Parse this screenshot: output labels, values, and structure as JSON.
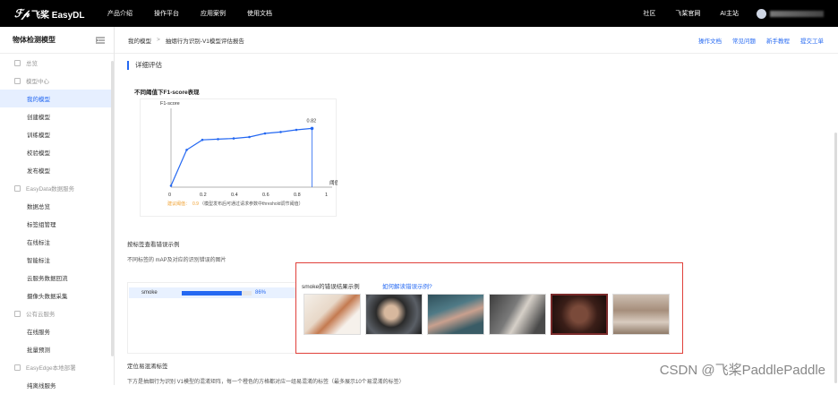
{
  "topbar": {
    "logo_mark": "飞桨",
    "logo_text": "飞桨 EasyDL",
    "nav": [
      "产品介绍",
      "操作平台",
      "应用案例",
      "使用文档"
    ],
    "right_links": [
      "社区",
      "飞桨官网",
      "AI主站"
    ]
  },
  "sidebar": {
    "title": "物体检测模型",
    "items": [
      {
        "label": "总览",
        "type": "group"
      },
      {
        "label": "模型中心",
        "type": "group"
      },
      {
        "label": "我的模型",
        "type": "item",
        "active": true
      },
      {
        "label": "创建模型",
        "type": "item"
      },
      {
        "label": "训练模型",
        "type": "item"
      },
      {
        "label": "校验模型",
        "type": "item"
      },
      {
        "label": "发布模型",
        "type": "item"
      },
      {
        "label": "EasyData数据服务",
        "type": "group"
      },
      {
        "label": "数据总览",
        "type": "item"
      },
      {
        "label": "标签组管理",
        "type": "item"
      },
      {
        "label": "在线标注",
        "type": "item"
      },
      {
        "label": "智能标注",
        "type": "item"
      },
      {
        "label": "云服务数据回流",
        "type": "item"
      },
      {
        "label": "摄像头数据采集",
        "type": "item"
      },
      {
        "label": "公有云服务",
        "type": "group"
      },
      {
        "label": "在线服务",
        "type": "item"
      },
      {
        "label": "批量预测",
        "type": "item"
      },
      {
        "label": "EasyEdge本地部署",
        "type": "group"
      },
      {
        "label": "纯离线服务",
        "type": "item"
      }
    ]
  },
  "breadcrumb": {
    "root": "我的模型",
    "separator": ">",
    "current": "抽烟行为识别-V1模型评估报告"
  },
  "quicklinks": [
    "操作文档",
    "常见问题",
    "新手教程",
    "提交工单"
  ],
  "main": {
    "section_title": "详细评估",
    "chart_title": "不同阈值下F1-score表现",
    "label_section_title": "按标签查看错误示例",
    "label_section_sub": "不同标签的 mAP及对应的识别错误的图片",
    "labels": [
      {
        "name": "smoke",
        "value": 0.86,
        "pct_text": "86%"
      }
    ],
    "confusion_title": "定位易混淆标签",
    "confusion_sub": "下方是抽烟行为识别 V1模型的混淆矩阵，每一个橙色的方格都对应一组易混淆的标签（最多展示10个易混淆的标签）"
  },
  "popup": {
    "title": "smoke的错误结果示例",
    "link": "如何解读错误示例?",
    "thumbs": [
      "thumb-1",
      "thumb-2",
      "thumb-3",
      "thumb-4",
      "thumb-5",
      "thumb-6"
    ]
  },
  "watermark": "CSDN @飞桨PaddlePaddle",
  "chart_data": {
    "type": "line",
    "title": "不同阈值下F1-score表现",
    "ylabel": "F1-score",
    "xlabel": "阈值",
    "x": [
      0,
      0.1,
      0.2,
      0.3,
      0.4,
      0.5,
      0.6,
      0.7,
      0.8,
      0.9
    ],
    "y": [
      0.02,
      0.52,
      0.66,
      0.67,
      0.68,
      0.7,
      0.75,
      0.77,
      0.8,
      0.82
    ],
    "xlim": [
      0,
      1
    ],
    "ylim": [
      0,
      1
    ],
    "xticks": [
      "0",
      "0.2",
      "0.4",
      "0.6",
      "0.8",
      "1"
    ],
    "highlight": {
      "x": 0.9,
      "y": 0.82,
      "label": "0.82"
    },
    "note_label": "建议阈值：",
    "note_value": "0.9",
    "note_text": "（模型发布后可通过请求参数中threshold调节阈值）",
    "color": "#2468f2"
  }
}
